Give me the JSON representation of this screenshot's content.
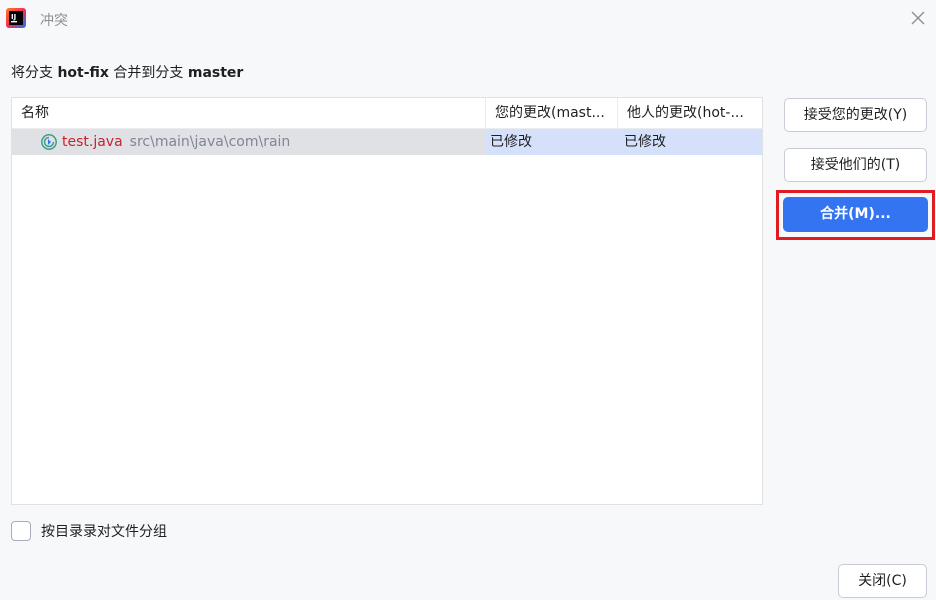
{
  "window": {
    "title": "冲突",
    "icons": {
      "app": "intellij-app-icon",
      "close": "close-icon"
    }
  },
  "description": {
    "prefix": "将分支 ",
    "source_branch": "hot-fix",
    "middle": " 合并到分支 ",
    "target_branch": "master"
  },
  "table": {
    "columns": [
      "名称",
      "您的更改(mast...",
      "他人的更改(hot-..."
    ],
    "rows": [
      {
        "icon": "conflict-file-icon",
        "file_name": "test.java",
        "path": "src\\main\\java\\com\\rain",
        "yours": "已修改",
        "theirs": "已修改",
        "selected": true
      }
    ]
  },
  "buttons": {
    "accept_yours": "接受您的更改(Y)",
    "accept_theirs": "接受他们的(T)",
    "merge": "合并(M)...",
    "close": "关闭(C)"
  },
  "options": {
    "group_by_directory": {
      "label": "按目录录对文件分组",
      "checked": false
    }
  },
  "colors": {
    "accent": "#3574f0",
    "highlight_box": "#e01b24",
    "conflict_file": "#c7222d"
  }
}
